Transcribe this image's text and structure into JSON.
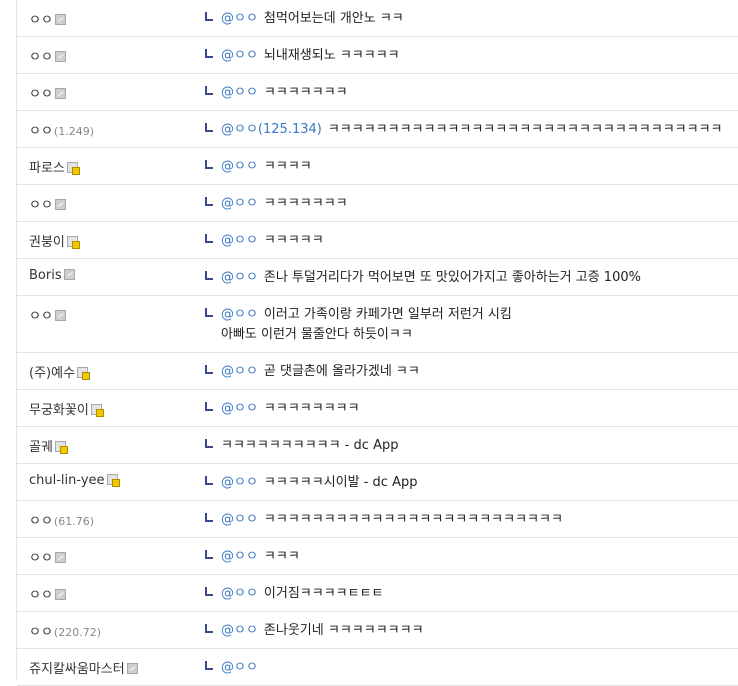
{
  "comments": [
    {
      "nick": "ㅇㅇ",
      "ip": "",
      "badge": "flow",
      "mention": "@ㅇㅇ",
      "mention_ip": "",
      "lines": [
        "첨먹어보는데 개안노 ㅋㅋ"
      ]
    },
    {
      "nick": "ㅇㅇ",
      "ip": "",
      "badge": "flow",
      "mention": "@ㅇㅇ",
      "mention_ip": "",
      "lines": [
        "뇌내재생되노 ㅋㅋㅋㅋㅋ"
      ]
    },
    {
      "nick": "ㅇㅇ",
      "ip": "",
      "badge": "flow",
      "mention": "@ㅇㅇ",
      "mention_ip": "",
      "lines": [
        "ㅋㅋㅋㅋㅋㅋㅋ"
      ]
    },
    {
      "nick": "ㅇㅇ",
      "ip": "(1.249)",
      "badge": "",
      "mention": "@ㅇㅇ",
      "mention_ip": "(125.134)",
      "lines": [
        "ㅋㅋㅋㅋㅋㅋㅋㅋㅋㅋㅋㅋㅋㅋㅋㅋㅋㅋㅋㅋㅋㅋㅋㅋㅋㅋㅋㅋㅋㅋㅋㅋㅋ"
      ]
    },
    {
      "nick": "파로스",
      "ip": "",
      "badge": "fixed",
      "mention": "@ㅇㅇ",
      "mention_ip": "",
      "lines": [
        "ㅋㅋㅋㅋ"
      ]
    },
    {
      "nick": "ㅇㅇ",
      "ip": "",
      "badge": "flow",
      "mention": "@ㅇㅇ",
      "mention_ip": "",
      "lines": [
        "ㅋㅋㅋㅋㅋㅋㅋ"
      ]
    },
    {
      "nick": "권붕이",
      "ip": "",
      "badge": "fixed",
      "mention": "@ㅇㅇ",
      "mention_ip": "",
      "lines": [
        "ㅋㅋㅋㅋㅋ"
      ]
    },
    {
      "nick": "Boris",
      "ip": "",
      "badge": "flow",
      "mention": "@ㅇㅇ",
      "mention_ip": "",
      "lines": [
        "존나 투덜거리다가 먹어보면 또 맛있어가지고 좋아하는거 고증 100%"
      ]
    },
    {
      "nick": "ㅇㅇ",
      "ip": "",
      "badge": "flow",
      "mention": "@ㅇㅇ",
      "mention_ip": "",
      "lines": [
        "이러고 가족이랑 카페가면 일부러 저런거 시킴",
        "아빠도 이런거 물줄안다 하듯이ㅋㅋ"
      ]
    },
    {
      "nick": "(주)예수",
      "ip": "",
      "badge": "fixed",
      "mention": "@ㅇㅇ",
      "mention_ip": "",
      "lines": [
        "곧 댓글촌에 올라가겠네 ㅋㅋ"
      ]
    },
    {
      "nick": "무궁화꽃이",
      "ip": "",
      "badge": "fixed",
      "mention": "@ㅇㅇ",
      "mention_ip": "",
      "lines": [
        "ㅋㅋㅋㅋㅋㅋㅋㅋ"
      ]
    },
    {
      "nick": "골궤",
      "ip": "",
      "badge": "fixed",
      "mention": "",
      "mention_ip": "",
      "lines": [
        "ㅋㅋㅋㅋㅋㅋㅋㅋㅋㅋ - dc App"
      ]
    },
    {
      "nick": "chul-lin-yee",
      "ip": "",
      "badge": "fixed",
      "mention": "@ㅇㅇ",
      "mention_ip": "",
      "lines": [
        "ㅋㅋㅋㅋㅋ시이발 - dc App"
      ]
    },
    {
      "nick": "ㅇㅇ",
      "ip": "(61.76)",
      "badge": "",
      "mention": "@ㅇㅇ",
      "mention_ip": "",
      "lines": [
        "ㅋㅋㅋㅋㅋㅋㅋㅋㅋㅋㅋㅋㅋㅋㅋㅋㅋㅋㅋㅋㅋㅋㅋㅋㅋ"
      ]
    },
    {
      "nick": "ㅇㅇ",
      "ip": "",
      "badge": "flow",
      "mention": "@ㅇㅇ",
      "mention_ip": "",
      "lines": [
        "ㅋㅋㅋ"
      ]
    },
    {
      "nick": "ㅇㅇ",
      "ip": "",
      "badge": "flow",
      "mention": "@ㅇㅇ",
      "mention_ip": "",
      "lines": [
        "이거짐ㅋㅋㅋㅋㅌㅌㅌ"
      ]
    },
    {
      "nick": "ㅇㅇ",
      "ip": "(220.72)",
      "badge": "",
      "mention": "@ㅇㅇ",
      "mention_ip": "",
      "lines": [
        "존나웃기네 ㅋㅋㅋㅋㅋㅋㅋㅋ"
      ]
    },
    {
      "nick": "쥬지칼싸움마스터",
      "ip": "",
      "badge": "flow",
      "mention": "@ㅇㅇ",
      "mention_ip": "",
      "lines": []
    }
  ]
}
